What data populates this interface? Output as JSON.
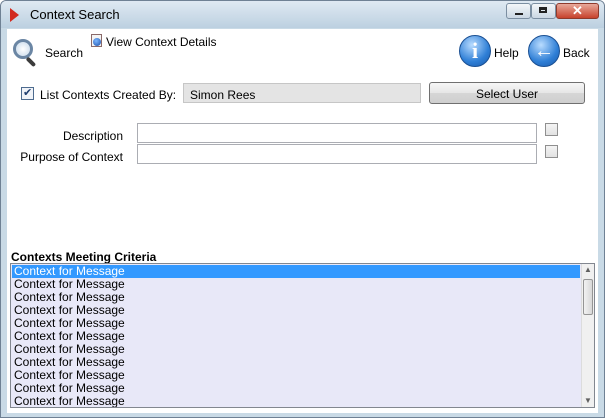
{
  "window": {
    "title": "Context Search",
    "close_glyph": "✕"
  },
  "toolbar": {
    "search_label": "Search",
    "view_details_label": "View Context Details",
    "help_label": "Help",
    "back_label": "Back",
    "help_icon_glyph": "i",
    "back_icon_glyph": "←"
  },
  "filters": {
    "list_created_by_label": "List Contexts Created By:",
    "list_created_by_checked": true,
    "user_value": "Simon Rees",
    "select_user_label": "Select User",
    "description_label": "Description",
    "description_value": "",
    "description_checked": false,
    "purpose_label": "Purpose of Context",
    "purpose_value": "",
    "purpose_checked": false
  },
  "results": {
    "title": "Contexts Meeting Criteria",
    "selected_index": 0,
    "items": [
      "Context for Message",
      "Context for Message",
      "Context for Message",
      "Context for Message",
      "Context for Message",
      "Context for Message",
      "Context for Message",
      "Context for Message",
      "Context for Message",
      "Context for Message",
      "Context for Message"
    ]
  },
  "colors": {
    "selection": "#3399ff",
    "list_background": "#e8e8f8",
    "titlebar": "#c9dae6",
    "close_button": "#c7422c"
  },
  "icons": {
    "app": "red-play-icon",
    "search": "magnifier-icon",
    "view_details": "document-globe-icon",
    "help": "info-circle-icon",
    "back": "back-arrow-icon"
  }
}
